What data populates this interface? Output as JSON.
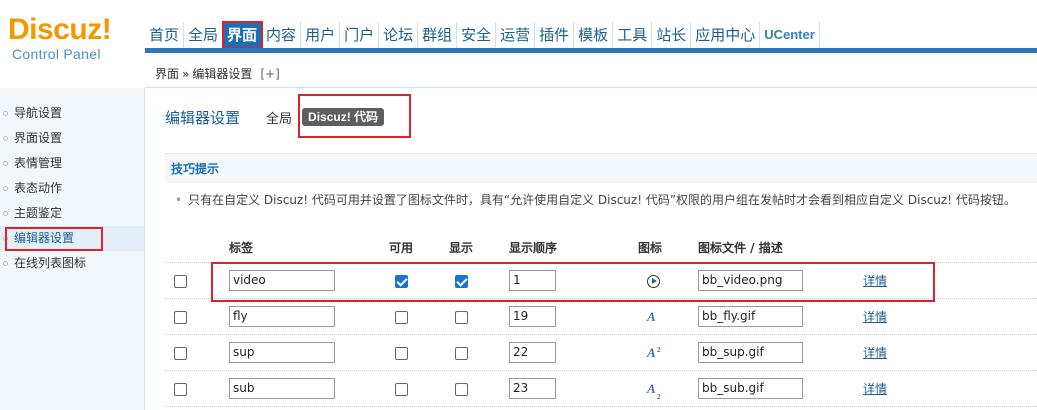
{
  "logo": {
    "main": "Discuz",
    "bang": "!",
    "sub": "Control Panel"
  },
  "nav": {
    "items": [
      "首页",
      "全局",
      "界面",
      "内容",
      "用户",
      "门户",
      "论坛",
      "群组",
      "安全",
      "运营",
      "插件",
      "模板",
      "工具",
      "站长",
      "应用中心",
      "UCenter"
    ],
    "active_index": 2
  },
  "breadcrumb": {
    "current": "界面",
    "sep": "»",
    "page": "编辑器设置",
    "plus": "[+]"
  },
  "sidebar": {
    "items": [
      "导航设置",
      "界面设置",
      "表情管理",
      "表态动作",
      "主题鉴定",
      "编辑器设置",
      "在线列表图标"
    ],
    "active_index": 5
  },
  "main": {
    "title": "编辑器设置",
    "tab_global": "全局",
    "tab_code": "Discuz! 代码"
  },
  "tips": {
    "header": "技巧提示",
    "text": "只有在自定义 Discuz! 代码可用并设置了图标文件时，具有“允许使用自定义 Discuz! 代码”权限的用户组在发帖时才会看到相应自定义 Discuz! 代码按钮。"
  },
  "table": {
    "headers": {
      "tag": "标签",
      "enabled": "可用",
      "display": "显示",
      "order": "显示顺序",
      "icon": "图标",
      "file": "图标文件 / 描述"
    },
    "detail_label": "详情",
    "rows": [
      {
        "tag": "video",
        "enabled": true,
        "display": true,
        "order": "1",
        "icon": "video-play-icon",
        "file": "bb_video.png"
      },
      {
        "tag": "fly",
        "enabled": false,
        "display": false,
        "order": "19",
        "icon": "italic-a-icon",
        "file": "bb_fly.gif"
      },
      {
        "tag": "sup",
        "enabled": false,
        "display": false,
        "order": "22",
        "icon": "superscript-icon",
        "file": "bb_sup.gif"
      },
      {
        "tag": "sub",
        "enabled": false,
        "display": false,
        "order": "23",
        "icon": "subscript-icon",
        "file": "bb_sub.gif"
      }
    ]
  },
  "colors": {
    "brand_orange": "#f39800",
    "nav_blue": "#1a6fb5",
    "highlight_red": "#d9232e"
  }
}
